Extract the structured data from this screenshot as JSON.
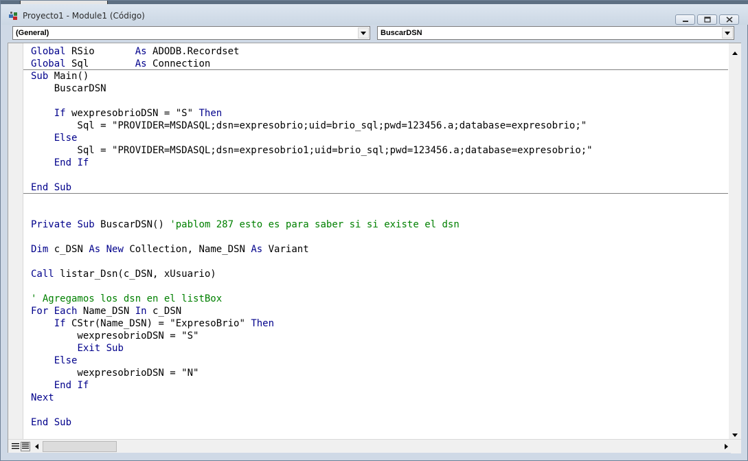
{
  "window": {
    "title": "Proyecto1 - Module1 (Código)"
  },
  "toolbar": {
    "object_combo": "(General)",
    "procedure_combo": "BuscarDSN"
  },
  "code": {
    "lines": [
      {
        "text": "Global RSio       As ADODB.Recordset",
        "kind": "code"
      },
      {
        "text": "Global Sql        As Connection",
        "kind": "code"
      },
      {
        "text": "Sub Main()",
        "kind": "code"
      },
      {
        "text": "    BuscarDSN",
        "kind": "code"
      },
      {
        "text": "",
        "kind": "code"
      },
      {
        "text": "    If wexpresobrioDSN = \"S\" Then",
        "kind": "code"
      },
      {
        "text": "        Sql = \"PROVIDER=MSDASQL;dsn=expresobrio;uid=brio_sql;pwd=123456.a;database=expresobrio;\"",
        "kind": "code"
      },
      {
        "text": "    Else",
        "kind": "code"
      },
      {
        "text": "        Sql = \"PROVIDER=MSDASQL;dsn=expresobrio1;uid=brio_sql;pwd=123456.a;database=expresobrio;\"",
        "kind": "code"
      },
      {
        "text": "    End If",
        "kind": "code"
      },
      {
        "text": "",
        "kind": "code"
      },
      {
        "text": "End Sub",
        "kind": "code"
      },
      {
        "text": "",
        "kind": "code"
      },
      {
        "text": "",
        "kind": "code"
      },
      {
        "text": "Private Sub BuscarDSN() ",
        "kind": "code",
        "comment": "'pablom 287 esto es para saber si si existe el dsn"
      },
      {
        "text": "",
        "kind": "code"
      },
      {
        "text": "Dim c_DSN As New Collection, Name_DSN As Variant",
        "kind": "code"
      },
      {
        "text": "",
        "kind": "code"
      },
      {
        "text": "Call listar_Dsn(c_DSN, xUsuario)",
        "kind": "code"
      },
      {
        "text": "",
        "kind": "code"
      },
      {
        "text": "' Agregamos los dsn en el listBox",
        "kind": "comment"
      },
      {
        "text": "For Each Name_DSN In c_DSN",
        "kind": "code"
      },
      {
        "text": "    If CStr(Name_DSN) = \"ExpresoBrio\" Then",
        "kind": "code"
      },
      {
        "text": "        wexpresobrioDSN = \"S\"",
        "kind": "code"
      },
      {
        "text": "        Exit Sub",
        "kind": "code"
      },
      {
        "text": "    Else",
        "kind": "code"
      },
      {
        "text": "        wexpresobrioDSN = \"N\"",
        "kind": "code"
      },
      {
        "text": "    End If",
        "kind": "code"
      },
      {
        "text": "Next",
        "kind": "code"
      },
      {
        "text": "",
        "kind": "code"
      },
      {
        "text": "End Sub",
        "kind": "code"
      }
    ]
  },
  "icons": {
    "app": "vba-project-icon",
    "minimize": "minimize-icon",
    "maximize": "maximize-icon",
    "close": "close-icon",
    "dropdown": "chevron-down-icon",
    "scroll_up": "arrow-up-icon",
    "scroll_down": "arrow-down-icon",
    "scroll_left": "arrow-left-icon",
    "scroll_right": "arrow-right-icon",
    "procedure_view": "procedure-view-icon",
    "full_module_view": "full-module-view-icon"
  },
  "colors": {
    "keyword": "#00008b",
    "comment": "#008000",
    "text": "#000000"
  }
}
